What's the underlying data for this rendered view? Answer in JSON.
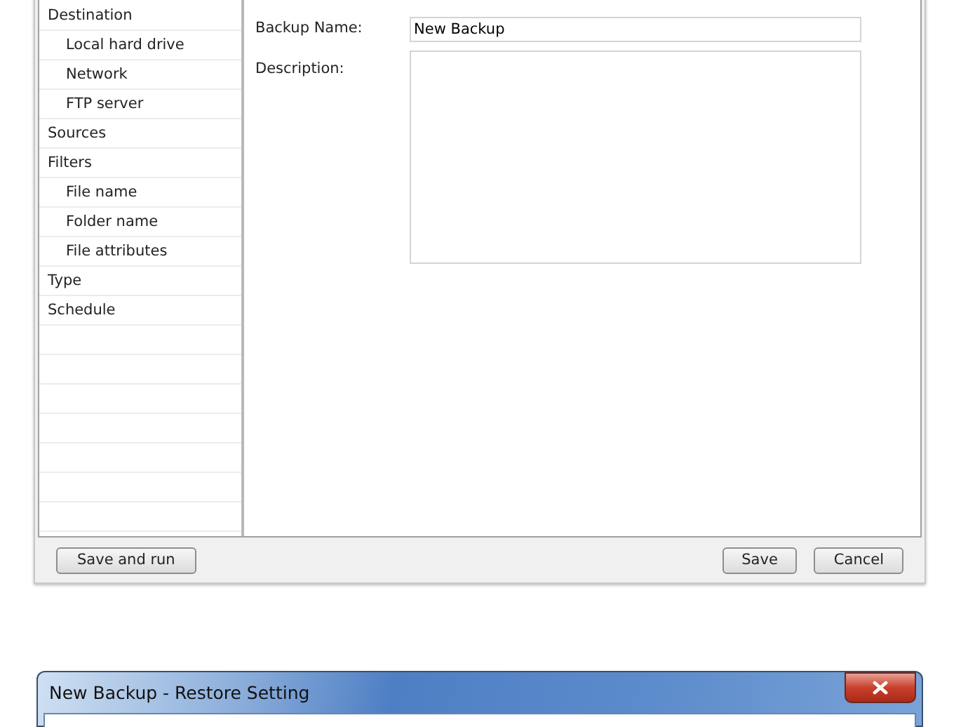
{
  "dialog": {
    "sidebar": {
      "items": [
        {
          "label": "Destination",
          "children": [
            {
              "label": "Local hard drive"
            },
            {
              "label": "Network"
            },
            {
              "label": "FTP server"
            }
          ]
        },
        {
          "label": "Sources"
        },
        {
          "label": "Filters",
          "children": [
            {
              "label": "File name"
            },
            {
              "label": "Folder name"
            },
            {
              "label": "File attributes"
            }
          ]
        },
        {
          "label": "Type"
        },
        {
          "label": "Schedule"
        }
      ]
    },
    "form": {
      "backup_name": {
        "label": "Backup Name:",
        "value": "New Backup"
      },
      "description": {
        "label": "Description:"
      }
    },
    "buttons": {
      "left": [
        "Save and run"
      ],
      "right": [
        "Save",
        "Cancel"
      ]
    }
  },
  "second_window": {
    "title": "New Backup - Restore Setting"
  }
}
